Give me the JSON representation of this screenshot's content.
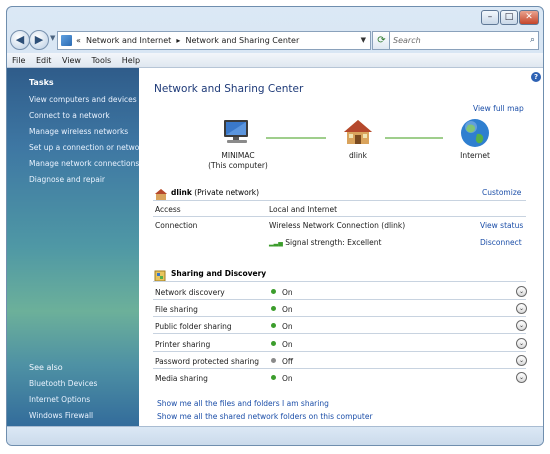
{
  "address": {
    "breadcrumb_prefix": "«",
    "breadcrumb_1": "Network and Internet",
    "breadcrumb_sep": "▸",
    "breadcrumb_2": "Network and Sharing Center",
    "search_placeholder": "Search"
  },
  "menu": [
    "File",
    "Edit",
    "View",
    "Tools",
    "Help"
  ],
  "sidebar": {
    "tasks_header": "Tasks",
    "tasks": [
      "View computers and devices",
      "Connect to a network",
      "Manage wireless networks",
      "Set up a connection or network",
      "Manage network connections",
      "Diagnose and repair"
    ],
    "see_also_header": "See also",
    "see_also": [
      "Bluetooth Devices",
      "Internet Options",
      "Windows Firewall"
    ]
  },
  "main": {
    "title": "Network and Sharing Center",
    "view_full_map": "View full map",
    "map": {
      "computer_name": "MINIMAC",
      "computer_sub": "(This computer)",
      "router_name": "dlink",
      "internet_name": "Internet"
    },
    "network": {
      "name": "dlink",
      "type": "(Private network)",
      "customize": "Customize",
      "access_label": "Access",
      "access_value": "Local and Internet",
      "connection_label": "Connection",
      "connection_value": "Wireless Network Connection (dlink)",
      "view_status": "View status",
      "signal_text": "Signal strength:  Excellent",
      "disconnect": "Disconnect"
    },
    "sharing": {
      "header": "Sharing and Discovery",
      "rows": [
        {
          "label": "Network discovery",
          "state": "On"
        },
        {
          "label": "File sharing",
          "state": "On"
        },
        {
          "label": "Public folder sharing",
          "state": "On"
        },
        {
          "label": "Printer sharing",
          "state": "On"
        },
        {
          "label": "Password protected sharing",
          "state": "Off"
        },
        {
          "label": "Media sharing",
          "state": "On"
        }
      ]
    },
    "links": [
      "Show me all the files and folders I am sharing",
      "Show me all the shared network folders on this computer"
    ]
  }
}
